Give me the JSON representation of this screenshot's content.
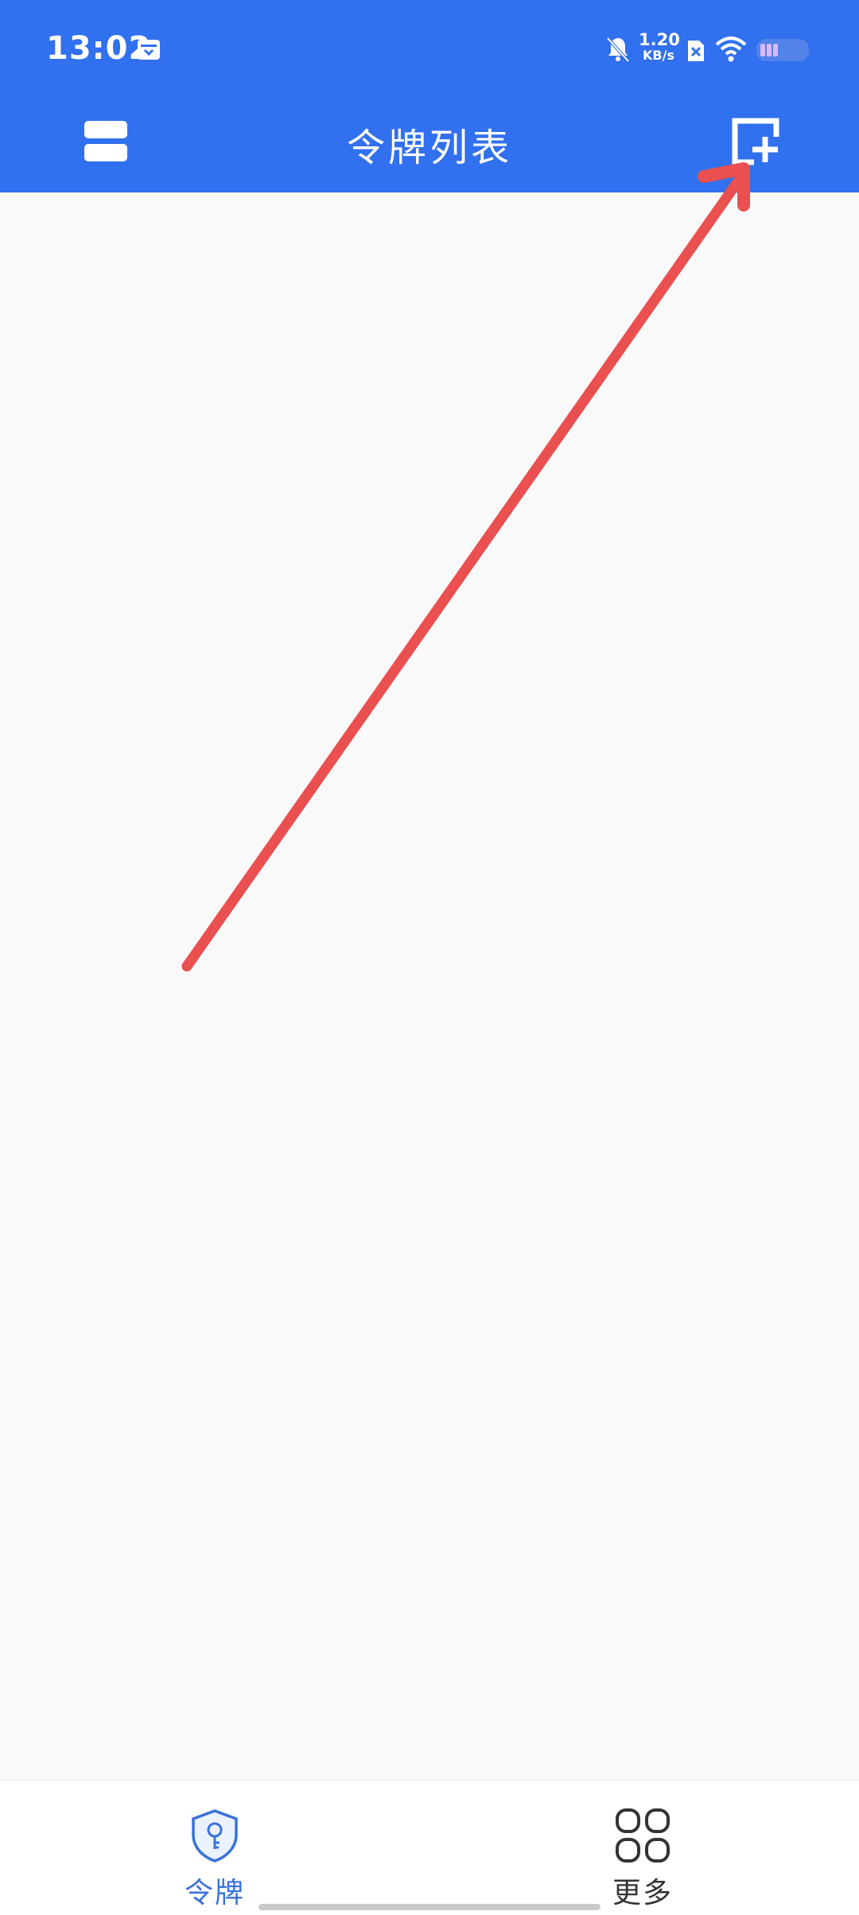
{
  "status_bar": {
    "time": "13:02",
    "network_speed_value": "1.20",
    "network_speed_unit": "KB/s"
  },
  "app_bar": {
    "title": "令牌列表"
  },
  "bottom_nav": {
    "items": [
      {
        "label": "令牌",
        "icon": "shield-key-icon",
        "active": true
      },
      {
        "label": "更多",
        "icon": "grid-four-icon",
        "active": false
      }
    ]
  },
  "colors": {
    "header_blue": "#3170ee",
    "active_tab": "#3a72d8",
    "annotation_arrow": "#e9504f",
    "background": "#faf9f9"
  }
}
